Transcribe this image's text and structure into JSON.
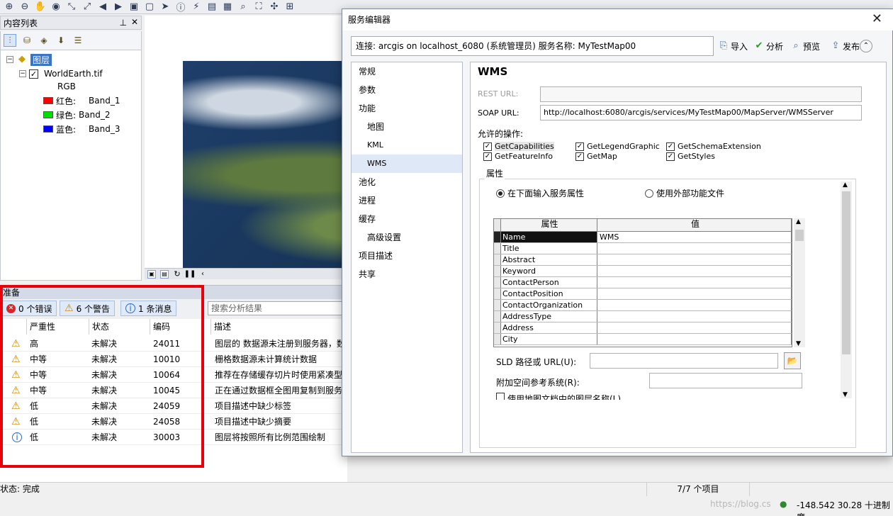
{
  "toc": {
    "title": "内容列表",
    "layers_label": "图层",
    "layer_name": "WorldEarth.tif",
    "rgb_label": "RGB",
    "bands": [
      {
        "label": "红色:",
        "band": "Band_1",
        "color": "#ff0000"
      },
      {
        "label": "绿色:",
        "band": "Band_2",
        "color": "#00e000"
      },
      {
        "label": "蓝色:",
        "band": "Band_3",
        "color": "#0000ff"
      }
    ]
  },
  "analysis": {
    "header": "准备",
    "errors_label": "0 个错误",
    "warnings_label": "6 个警告",
    "messages_label": "1 条消息",
    "search_placeholder": "搜索分析结果",
    "columns": [
      "严重性",
      "状态",
      "编码",
      "描述"
    ],
    "rows": [
      {
        "severity": "高",
        "status": "未解决",
        "code": "24011",
        "desc": "图层的  数据源未注册到服务器，数",
        "icon": "warning"
      },
      {
        "severity": "中等",
        "status": "未解决",
        "code": "10010",
        "desc": "栅格数据源未计算统计数据",
        "icon": "warning"
      },
      {
        "severity": "中等",
        "status": "未解决",
        "code": "10064",
        "desc": "推荐在存储缓存切片时使用紧凑型",
        "icon": "warning"
      },
      {
        "severity": "中等",
        "status": "未解决",
        "code": "10045",
        "desc": "正在通过数据框全图用复制到服务",
        "icon": "warning"
      },
      {
        "severity": "低",
        "status": "未解决",
        "code": "24059",
        "desc": "项目描述中缺少标签",
        "icon": "warning"
      },
      {
        "severity": "低",
        "status": "未解决",
        "code": "24058",
        "desc": "项目描述中缺少摘要",
        "icon": "warning"
      },
      {
        "severity": "低",
        "status": "未解决",
        "code": "30003",
        "desc": "图层将按照所有比例范围绘制",
        "icon": "info"
      }
    ]
  },
  "status": {
    "left": "状态: 完成",
    "count": "7/7 个项目",
    "coords": "-148.542  30.28 十进制度",
    "watermark": "https://blog.cs"
  },
  "dialog": {
    "title": "服务编辑器",
    "connection": "连接: arcgis on localhost_6080 (系统管理员)    服务名称: MyTestMap00",
    "tools": {
      "import": "导入",
      "analyze": "分析",
      "preview": "预览",
      "publish": "发布"
    },
    "nav": [
      "常规",
      "参数",
      "功能",
      "地图",
      "KML",
      "WMS",
      "池化",
      "进程",
      "缓存",
      "高级设置",
      "项目描述",
      "共享"
    ],
    "content": {
      "title": "WMS",
      "rest_url_label": "REST URL:",
      "rest_url_value": "",
      "soap_url_label": "SOAP URL:",
      "soap_url_value": "http://localhost:6080/arcgis/services/MyTestMap00/MapServer/WMSServer",
      "ops_label": "允许的操作:",
      "ops": [
        "GetCapabilities",
        "GetLegendGraphic",
        "GetSchemaExtension",
        "GetFeatureInfo",
        "GetMap",
        "GetStyles"
      ],
      "props_label": "属性",
      "radio_input": "在下面输入服务属性",
      "radio_external": "使用外部功能文件",
      "grid_headers": [
        "属性",
        "值"
      ],
      "grid_rows": [
        {
          "name": "Name",
          "value": "WMS"
        },
        {
          "name": "Title",
          "value": ""
        },
        {
          "name": "Abstract",
          "value": ""
        },
        {
          "name": "Keyword",
          "value": ""
        },
        {
          "name": "ContactPerson",
          "value": ""
        },
        {
          "name": "ContactPosition",
          "value": ""
        },
        {
          "name": "ContactOrganization",
          "value": ""
        },
        {
          "name": "AddressType",
          "value": ""
        },
        {
          "name": "Address",
          "value": ""
        },
        {
          "name": "City",
          "value": ""
        }
      ],
      "sld_label": "SLD 路径或 URL(U):",
      "sld_value": "",
      "extra_srs_label": "附加空间参考系统(R):",
      "extra_srs_value": "",
      "use_layer_names": "使用地图文档中的图层名称(L)"
    }
  }
}
